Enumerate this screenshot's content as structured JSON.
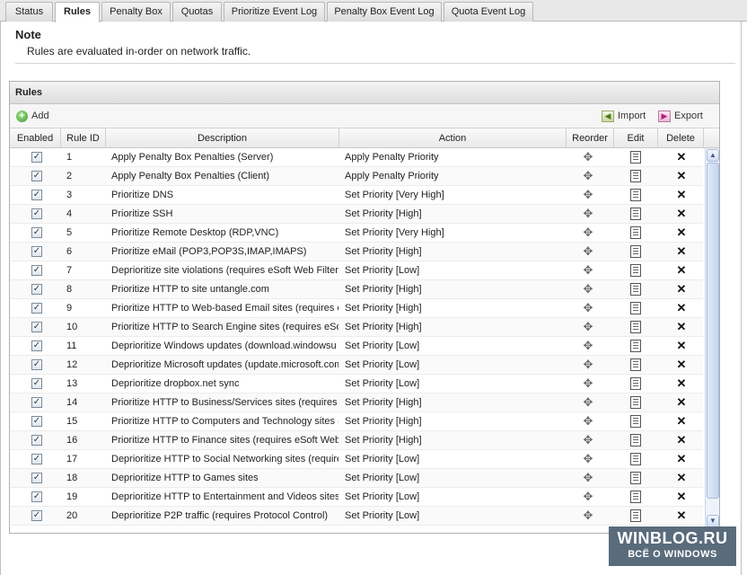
{
  "tabs": [
    {
      "label": "Status",
      "active": false
    },
    {
      "label": "Rules",
      "active": true
    },
    {
      "label": "Penalty Box",
      "active": false
    },
    {
      "label": "Quotas",
      "active": false
    },
    {
      "label": "Prioritize Event Log",
      "active": false
    },
    {
      "label": "Penalty Box Event Log",
      "active": false
    },
    {
      "label": "Quota Event Log",
      "active": false
    }
  ],
  "note": {
    "title": "Note",
    "text": "Rules are evaluated in-order on network traffic."
  },
  "panel": {
    "title": "Rules",
    "toolbar": {
      "add_label": "Add",
      "import_label": "Import",
      "export_label": "Export"
    },
    "columns": [
      "Enabled",
      "Rule ID",
      "Description",
      "Action",
      "Reorder",
      "Edit",
      "Delete"
    ],
    "rows": [
      {
        "enabled": true,
        "id": "1",
        "description": "Apply Penalty Box Penalties (Server)",
        "action": "Apply Penalty Priority"
      },
      {
        "enabled": true,
        "id": "2",
        "description": "Apply Penalty Box Penalties (Client)",
        "action": "Apply Penalty Priority"
      },
      {
        "enabled": true,
        "id": "3",
        "description": "Prioritize DNS",
        "action": "Set Priority [Very High]"
      },
      {
        "enabled": true,
        "id": "4",
        "description": "Prioritize SSH",
        "action": "Set Priority [High]"
      },
      {
        "enabled": true,
        "id": "5",
        "description": "Prioritize Remote Desktop (RDP,VNC)",
        "action": "Set Priority [Very High]"
      },
      {
        "enabled": true,
        "id": "6",
        "description": "Prioritize eMail (POP3,POP3S,IMAP,IMAPS)",
        "action": "Set Priority [High]"
      },
      {
        "enabled": true,
        "id": "7",
        "description": "Deprioritize site violations (requires eSoft Web Filter)",
        "action": "Set Priority [Low]"
      },
      {
        "enabled": true,
        "id": "8",
        "description": "Prioritize HTTP to site untangle.com",
        "action": "Set Priority [High]"
      },
      {
        "enabled": true,
        "id": "9",
        "description": "Prioritize HTTP to Web-based Email sites (requires eS",
        "action": "Set Priority [High]"
      },
      {
        "enabled": true,
        "id": "10",
        "description": "Prioritize HTTP to Search Engine sites (requires eSof",
        "action": "Set Priority [High]"
      },
      {
        "enabled": true,
        "id": "11",
        "description": "Deprioritize Windows updates (download.windowsu",
        "action": "Set Priority [Low]"
      },
      {
        "enabled": true,
        "id": "12",
        "description": "Deprioritize Microsoft updates (update.microsoft.com",
        "action": "Set Priority [Low]"
      },
      {
        "enabled": true,
        "id": "13",
        "description": "Deprioritize dropbox.net sync",
        "action": "Set Priority [Low]"
      },
      {
        "enabled": true,
        "id": "14",
        "description": "Prioritize HTTP to Business/Services sites (requires e",
        "action": "Set Priority [High]"
      },
      {
        "enabled": true,
        "id": "15",
        "description": "Prioritize HTTP to Computers and Technology sites (r",
        "action": "Set Priority [High]"
      },
      {
        "enabled": true,
        "id": "16",
        "description": "Prioritize HTTP to Finance sites (requires eSoft Web F",
        "action": "Set Priority [High]"
      },
      {
        "enabled": true,
        "id": "17",
        "description": "Deprioritize HTTP to Social Networking sites (requires",
        "action": "Set Priority [Low]"
      },
      {
        "enabled": true,
        "id": "18",
        "description": "Deprioritize HTTP to Games sites",
        "action": "Set Priority [Low]"
      },
      {
        "enabled": true,
        "id": "19",
        "description": "Deprioritize HTTP to Entertainment and Videos sites (",
        "action": "Set Priority [Low]"
      },
      {
        "enabled": true,
        "id": "20",
        "description": "Deprioritize P2P traffic (requires Protocol Control)",
        "action": "Set Priority [Low]"
      }
    ]
  },
  "icons": {
    "add": "plus-circle-icon",
    "import": "import-icon",
    "export": "export-icon",
    "reorder": "move-arrows-icon",
    "edit": "edit-document-icon",
    "delete": "delete-x-icon",
    "checkbox": "checkbox-checked-icon"
  },
  "watermark": {
    "line1": "WINBLOG.RU",
    "line2": "ВСЁ О WINDOWS"
  }
}
